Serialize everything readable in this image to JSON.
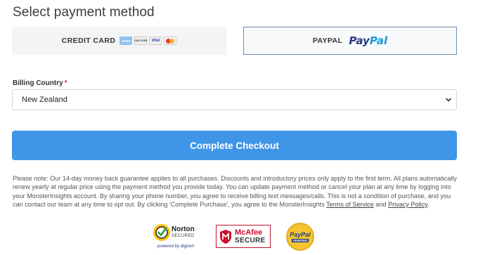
{
  "heading": "Select payment method",
  "payment_methods": {
    "credit_card": {
      "label": "CREDIT CARD",
      "cards": [
        "AMEX",
        "DISCOVER",
        "VISA",
        "Mastercard"
      ]
    },
    "paypal": {
      "label": "PAYPAL",
      "logo_part1": "Pay",
      "logo_part2": "Pal",
      "selected": true
    }
  },
  "billing": {
    "label": "Billing Country",
    "required_marker": "*",
    "selected_country": "New Zealand"
  },
  "checkout_button": "Complete Checkout",
  "note": {
    "text": "Please note: Our 14-day money back guarantee applies to all purchases. Discounts and introductory prices only apply to the first term. All plans automatically renew yearly at regular price using the payment method you provide today. You can update payment method or cancel your plan at any time by logging into your MonsterInsights account. By sharing your phone number, you agree to receive billing text messages/calls. This is not a condition of purchase, and you can contact our team at any time to opt out. By clicking 'Complete Purchase', you agree to the MonsterInsights ",
    "terms_link": "Terms of Service",
    "and": " and ",
    "privacy_link": "Privacy Policy",
    "end": "."
  },
  "badges": {
    "norton": {
      "line1": "Norton",
      "line2": "SECURED",
      "line3": "powered by digicert"
    },
    "mcafee": {
      "line1": "McAfee",
      "line2": "SECURE"
    },
    "paypal_verified": {
      "line1": "PayPal",
      "line2": "VERIFIED"
    }
  },
  "colors": {
    "accent": "#3f95e8",
    "paypal_dark": "#253b80",
    "paypal_light": "#179bd7",
    "selected_border": "#6d8db3",
    "required": "#d62d2d"
  }
}
